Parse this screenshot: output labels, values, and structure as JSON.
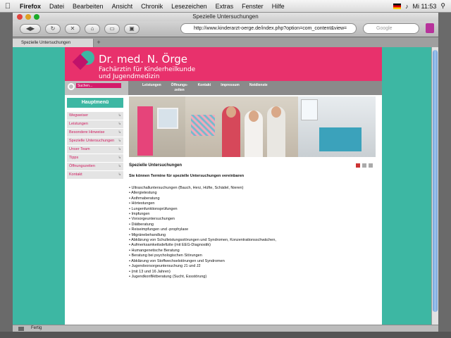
{
  "menubar": {
    "apple": "",
    "app": "Firefox",
    "items": [
      "Datei",
      "Bearbeiten",
      "Ansicht",
      "Chronik",
      "Lesezeichen",
      "Extras",
      "Fenster",
      "Hilfe"
    ],
    "clock": "Mi 11:53"
  },
  "window": {
    "title": "Spezielle Untersuchungen"
  },
  "toolbar": {
    "url": "http://www.kinderarzt-oerge.de/index.php?option=com_content&view=",
    "search_placeholder": "Google"
  },
  "tabs": [
    {
      "label": "Spezielle Untersuchungen"
    }
  ],
  "tab_add": "+",
  "site": {
    "doctor": "Dr. med. N. Örge",
    "subtitle1": "Fachärztin für Kinderheilkunde",
    "subtitle2": "und Jugendmedizin",
    "search_placeholder": "Suchen...",
    "topnav": [
      "Leistungen",
      "Öffnungs-\nzeiten",
      "Kontakt",
      "Impressum",
      "Notdienste"
    ],
    "menu_title": "Hauptmenü",
    "sidebar": [
      "Wegweiser",
      "Leistungen",
      "Besondere Hinweise",
      "Spezielle Untersuchungen",
      "Unser Team",
      "Tipps",
      "Öffnungszeiten",
      "Kontakt"
    ],
    "content_title": "Spezielle Untersuchungen",
    "content_sub": "Sie können Termine für spezielle Untersuchungen vereinbaren",
    "services": [
      "Ultraschalluntersuchungen (Bauch, Herz, Hüfte, Schädel, Nieren)",
      "Allergietestung",
      "Asthmaberatung",
      "Hörtestungen",
      "Lungenfunktionsprüfungen",
      "Impfungen",
      "Vorsorgeuntersuchungen",
      "Diätberatung",
      "Reiseimpfungen und -prophylaxe",
      "Migränebehandlung",
      "Abklärung von Schulleistungsstörungen und Syndromen, Konzentrationsschwächen,",
      "Aufmerksamkeitsdefizite (mit EEG-Diagnostik)",
      "Humangenetische Beratung",
      "Beratung bei psychologischen Störungen",
      "Abklärung von Stoffwechselstörungen und Syndromen",
      "Jugendvorsorgeuntersuchung J1 und J2",
      "(mit 13 und 16 Jahren)",
      "Jugendkonfliktberatung (Sucht, Essstörung)"
    ]
  },
  "status": {
    "text": "Fertig"
  },
  "colors": {
    "brand_pink": "#e8316c",
    "teal": "#3db7a3",
    "nav_gray": "#8a8a8a"
  }
}
